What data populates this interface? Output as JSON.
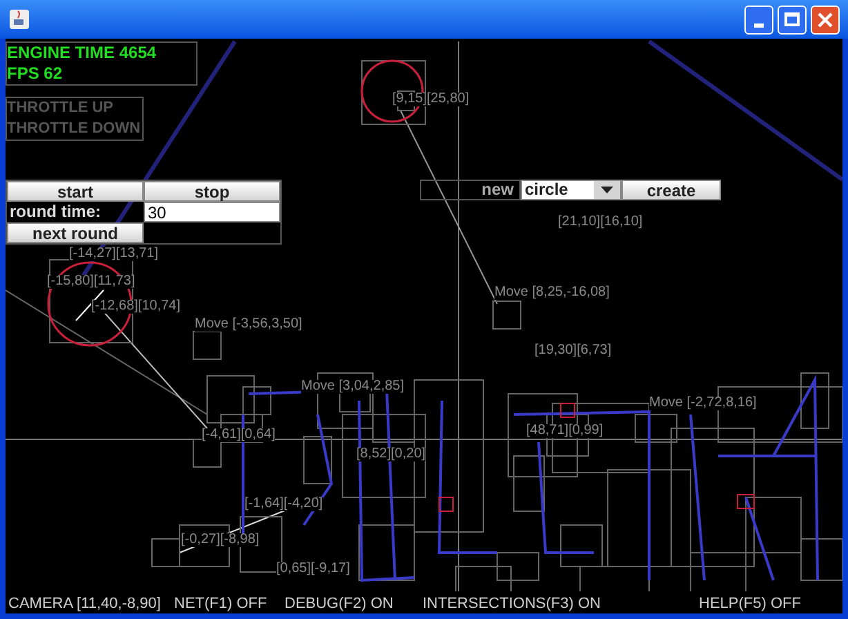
{
  "hud": {
    "lines": [
      "ENGINE TIME 4654",
      "FPS 62"
    ]
  },
  "throttle": [
    "THROTTLE UP",
    "THROTTLE DOWN"
  ],
  "round_panel": {
    "start": "start",
    "stop": "stop",
    "round_time_label": "round time:",
    "round_time_value": "30",
    "next_round": "next round"
  },
  "create_panel": {
    "label": "new",
    "shape": "circle",
    "create": "create"
  },
  "scene_labels": [
    {
      "text": "[9,15][25,80]"
    },
    {
      "text": "[21,10][16,10]"
    },
    {
      "text": "Move [8,25,-16,08]"
    },
    {
      "text": "[-14,27][13,71]"
    },
    {
      "text": "[-15,80][11,73]"
    },
    {
      "text": "[-12,68][10,74]"
    },
    {
      "text": "Move [-3,56,3,50]"
    },
    {
      "text": "Move [3,04,2,85]"
    },
    {
      "text": "[-4,61][0,64]"
    },
    {
      "text": "[8,52][0,20]"
    },
    {
      "text": "[-1,64][-4,20]"
    },
    {
      "text": "[-0,27][-8,98]"
    },
    {
      "text": "[0,65][-9,17]"
    },
    {
      "text": "[19,30][6,73]"
    },
    {
      "text": "Move [-2,72,8,16]"
    },
    {
      "text": "[48,71][0,99]"
    }
  ],
  "status_bar": [
    "CAMERA [11,40,-8,90]",
    "NET(F1) OFF",
    "DEBUG(F2) ON",
    "INTERSECTIONS(F3) ON",
    "HELP(F5) OFF"
  ]
}
